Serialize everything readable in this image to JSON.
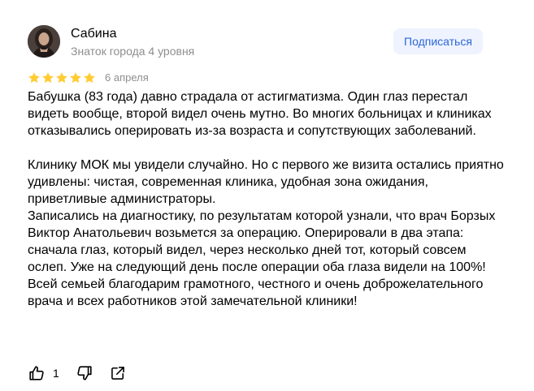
{
  "author": {
    "name": "Сабина",
    "level": "Знаток города 4 уровня",
    "avatar_icon": "user-photo"
  },
  "subscribe_label": "Подписаться",
  "rating": {
    "stars": 5,
    "max_stars": 5,
    "star_color": "#fc3"
  },
  "date": "6 апреля",
  "text": {
    "p1": "Бабушка (83 года) давно страдала от астигматизма. Один глаз перестал видеть вообще, второй видел очень мутно. Во многих больницах и клиниках отказывались оперировать из-за возраста и сопутствующих заболеваний.",
    "p2": "Клинику МОК мы увидели случайно. Но с первого же визита остались приятно удивлены: чистая, современная клиника, удобная зона ожидания, приветливые администраторы.",
    "p3": "Записались на диагностику, по результатам которой узнали, что врач Борзых Виктор Анатольевич возьмется за операцию. Оперировали в два этапа: сначала глаз, который видел, через несколько дней тот, который совсем ослеп. Уже на следующий день после операции оба глаза видели на 100%!",
    "p4": "Всей семьей благодарим грамотного, честного и очень доброжелательного врача и всех работников этой замечательной клиники!"
  },
  "actions": {
    "like_count": "1",
    "like_icon": "thumbs-up-icon",
    "dislike_icon": "thumbs-down-icon",
    "share_icon": "share-icon"
  },
  "colors": {
    "accent": "#2c67d8",
    "button_bg": "#eef3ff",
    "muted_text": "#8e8e8e"
  }
}
